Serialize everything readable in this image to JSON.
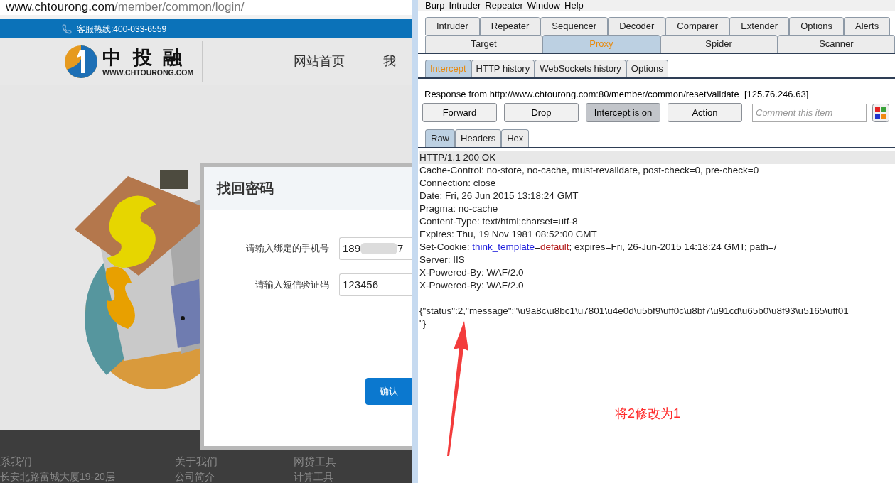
{
  "browser": {
    "url_host": "www.chtourong.com",
    "url_path": "/member/common/login/"
  },
  "site": {
    "hotline": "客服热线:400-033-6559",
    "logo_name": "中 投 融",
    "logo_domain": "WWW.CHTOURONG.COM",
    "nav": [
      "网站首页",
      "我"
    ],
    "dialog": {
      "title": "找回密码",
      "fields": [
        {
          "label": "请输入绑定的手机号",
          "value_start": "189",
          "value_end": "7",
          "redacted": true
        },
        {
          "label": "请输入短信验证码",
          "value_start": "123456",
          "redacted": false
        }
      ],
      "confirm": "确认"
    },
    "footer": [
      {
        "heading": "系我们",
        "lines": [
          "长安北路富城大厦19-20层"
        ]
      },
      {
        "heading": "关于我们",
        "lines": [
          "公司简介"
        ]
      },
      {
        "heading": "网贷工具",
        "lines": [
          "计算工具"
        ]
      }
    ]
  },
  "burp": {
    "menu": [
      "Burp",
      "Intruder",
      "Repeater",
      "Window",
      "Help"
    ],
    "tabs_row1": [
      {
        "label": "Intruder",
        "selected": false
      },
      {
        "label": "Repeater",
        "selected": false
      },
      {
        "label": "Sequencer",
        "selected": false
      },
      {
        "label": "Decoder",
        "selected": false
      },
      {
        "label": "Comparer",
        "selected": false
      },
      {
        "label": "Extender",
        "selected": false
      },
      {
        "label": "Options",
        "selected": false
      },
      {
        "label": "Alerts",
        "selected": false
      }
    ],
    "tabs_row2": [
      {
        "label": "Target",
        "selected": false
      },
      {
        "label": "Proxy",
        "selected": true
      },
      {
        "label": "Spider",
        "selected": false
      },
      {
        "label": "Scanner",
        "selected": false
      }
    ],
    "proxy_tabs": [
      {
        "label": "Intercept",
        "selected": true
      },
      {
        "label": "HTTP history",
        "selected": false
      },
      {
        "label": "WebSockets history",
        "selected": false
      },
      {
        "label": "Options",
        "selected": false
      }
    ],
    "response_from": "Response from http://www.chtourong.com:80/member/common/resetValidate  [125.76.246.63]",
    "buttons": [
      {
        "label": "Forward",
        "pressed": false
      },
      {
        "label": "Drop",
        "pressed": false
      },
      {
        "label": "Intercept is on",
        "pressed": true
      },
      {
        "label": "Action",
        "pressed": false
      }
    ],
    "comment": {
      "placeholder": "Comment this item"
    },
    "view_tabs": [
      {
        "label": "Raw",
        "selected": true
      },
      {
        "label": "Headers",
        "selected": false
      },
      {
        "label": "Hex",
        "selected": false
      }
    ],
    "message_headers": [
      {
        "highlighted": true,
        "segments": [
          {
            "kind": "plain",
            "text": "HTTP/1.1 200 OK"
          }
        ]
      },
      {
        "highlighted": false,
        "segments": [
          {
            "kind": "plain",
            "text": "Cache-Control: no-store, no-cache, must-revalidate, post-check=0, pre-check=0"
          }
        ]
      },
      {
        "highlighted": false,
        "segments": [
          {
            "kind": "plain",
            "text": "Connection: close"
          }
        ]
      },
      {
        "highlighted": false,
        "segments": [
          {
            "kind": "plain",
            "text": "Date: Fri, 26 Jun 2015 13:18:24 GMT"
          }
        ]
      },
      {
        "highlighted": false,
        "segments": [
          {
            "kind": "plain",
            "text": "Pragma: no-cache"
          }
        ]
      },
      {
        "highlighted": false,
        "segments": [
          {
            "kind": "plain",
            "text": "Content-Type: text/html;charset=utf-8"
          }
        ]
      },
      {
        "highlighted": false,
        "segments": [
          {
            "kind": "plain",
            "text": "Expires: Thu, 19 Nov 1981 08:52:00 GMT"
          }
        ]
      },
      {
        "highlighted": false,
        "segments": [
          {
            "kind": "plain",
            "text": "Set-Cookie: "
          },
          {
            "kind": "name",
            "text": "think_template"
          },
          {
            "kind": "plain",
            "text": "="
          },
          {
            "kind": "value",
            "text": "default"
          },
          {
            "kind": "plain",
            "text": "; expires=Fri, 26-Jun-2015 14:18:24 GMT; path=/"
          }
        ]
      },
      {
        "highlighted": false,
        "segments": [
          {
            "kind": "plain",
            "text": "Server: IIS"
          }
        ]
      },
      {
        "highlighted": false,
        "segments": [
          {
            "kind": "plain",
            "text": "X-Powered-By: WAF/2.0"
          }
        ]
      },
      {
        "highlighted": false,
        "segments": [
          {
            "kind": "plain",
            "text": "X-Powered-By: WAF/2.0"
          }
        ]
      }
    ],
    "message_body": [
      {
        "highlighted": false,
        "segments": [
          {
            "kind": "plain",
            "text": "{\"status\":2,\"message\":\"\\u9a8c\\u8bc1\\u7801\\u4e0d\\u5bf9\\uff0c\\u8bf7\\u91cd\\u65b0\\u8f93\\u5165\\uff01"
          }
        ]
      },
      {
        "highlighted": false,
        "segments": [
          {
            "kind": "plain",
            "text": "\"}"
          }
        ]
      }
    ]
  },
  "annotation": {
    "text": "将2修改为1"
  }
}
